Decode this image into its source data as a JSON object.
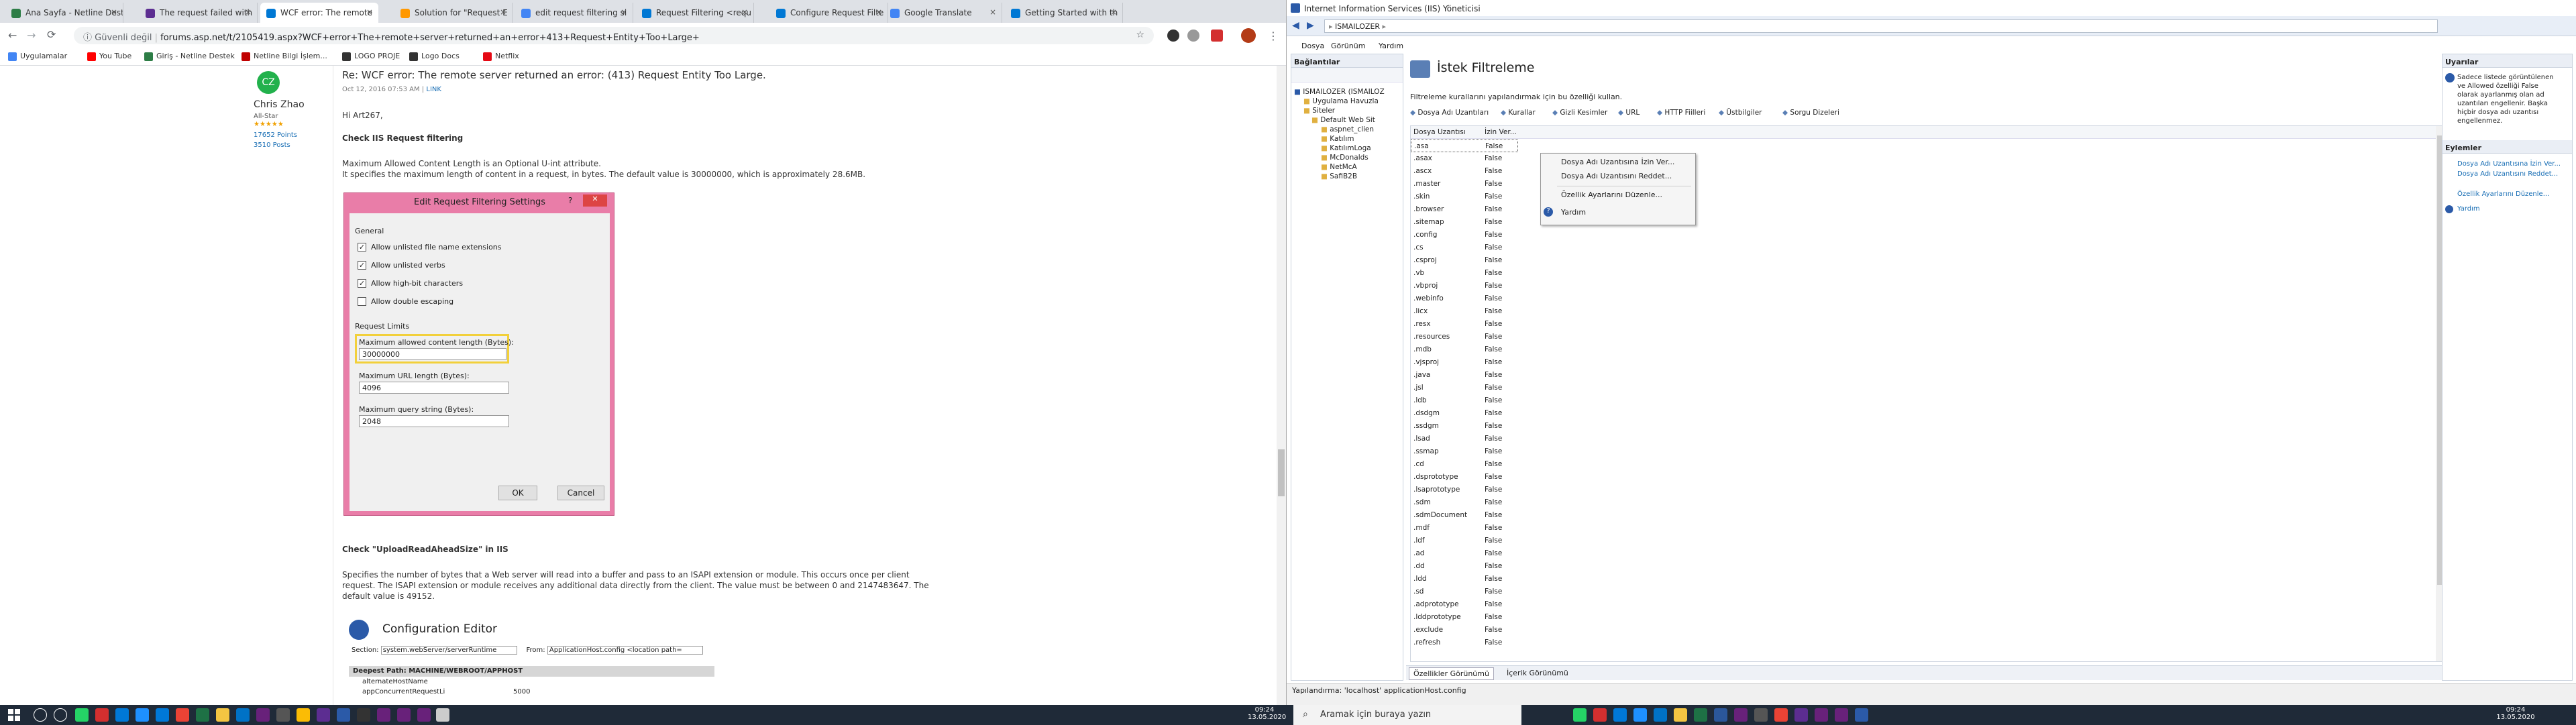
{
  "browser": {
    "tabs": [
      {
        "title": "Ana Sayfa - Netline Dest",
        "color": "#2d7d46"
      },
      {
        "title": "The request failed with",
        "color": "#5c2d91"
      },
      {
        "title": "WCF error: The remote",
        "color": "#0078d4"
      },
      {
        "title": "Solution for \"Request E",
        "color": "#ff9800"
      },
      {
        "title": "edit request filtering si",
        "color": "#4285f4"
      },
      {
        "title": "Request Filtering <requ",
        "color": "#0078d4"
      },
      {
        "title": "Configure Request Filte",
        "color": "#0078d4"
      },
      {
        "title": "Google Translate",
        "color": "#4285f4"
      },
      {
        "title": "Getting Started with th",
        "color": "#0078d4"
      }
    ],
    "security_label": "Güvenli değil",
    "url": "forums.asp.net/t/2105419.aspx?WCF+error+The+remote+server+returned+an+error+413+Request+Entity+Too+Large+",
    "bookmarks": [
      {
        "label": "Uygulamalar",
        "color": "#4285f4"
      },
      {
        "label": "You Tube",
        "color": "#ff0000"
      },
      {
        "label": "Giriş - Netline Destek",
        "color": "#2d7d46"
      },
      {
        "label": "Netline Bilgi İşlem...",
        "color": "#c00000"
      },
      {
        "label": "LOGO PROJE",
        "color": "#333333"
      },
      {
        "label": "Logo Docs",
        "color": "#333333"
      },
      {
        "label": "Netflix",
        "color": "#e50914"
      }
    ]
  },
  "post": {
    "title": "Re: WCF error: The remote server returned an error: (413) Request Entity Too Large.",
    "date": "Oct 12, 2016 07:53 AM",
    "link": "LINK",
    "author_initials": "CZ",
    "author_name": "Chris Zhao",
    "author_rank": "All-Star",
    "author_stars": "★★★★★",
    "points": "17652 Points",
    "posts": "3510 Posts",
    "greeting": "Hi Art267,",
    "heading1": "Check IIS Request filtering",
    "para1_line1": "Maximum Allowed Content Length is an Optional U-int attribute.",
    "para1_line2": "It specifies the maximum length of content in a request, in bytes. The default value is 30000000, which is approximately 28.6MB.",
    "heading2": "Check \"UploadReadAheadSize\" in IIS",
    "para2_line1": "Specifies the number of bytes that a Web server will read into a buffer and pass to an ISAPI extension or module. This occurs once per client",
    "para2_line2": "request. The ISAPI extension or module receives any additional data directly from the client. The value must be between 0 and 2147483647. The",
    "para2_line3": "default value is 49152.",
    "config_title": "Configuration Editor",
    "config_section_label": "Section:",
    "config_section_value": "system.webServer/serverRuntime",
    "config_from_label": "From:",
    "config_from_value": "ApplicationHost.config <location path=",
    "config_deepest": "Deepest Path: MACHINE/WEBROOT/APPHOST",
    "config_row1": "alternateHostName",
    "config_row2": "appConcurrentRequestLi",
    "config_row2_val": "5000"
  },
  "dialog": {
    "title": "Edit Request Filtering Settings",
    "help": "?",
    "close": "✕",
    "general_label": "General",
    "opt1": "Allow unlisted file name extensions",
    "opt2": "Allow unlisted verbs",
    "opt3": "Allow high-bit characters",
    "opt4": "Allow double escaping",
    "opt1_checked": "✓",
    "opt2_checked": "✓",
    "opt3_checked": "✓",
    "limits_label": "Request Limits",
    "max_content_label": "Maximum allowed content length (Bytes):",
    "max_content_value": "30000000",
    "max_url_label": "Maximum URL length (Bytes):",
    "max_url_value": "4096",
    "max_query_label": "Maximum query string (Bytes):",
    "max_query_value": "2048",
    "ok": "OK",
    "cancel": "Cancel"
  },
  "iis": {
    "window_title": "Internet Information Services (IIS) Yöneticisi",
    "address": "ISMAILOZER",
    "menu": [
      "Dosya",
      "Görünüm",
      "Yardım"
    ],
    "connections_title": "Bağlantılar",
    "tree": [
      "ISMAILOZER (ISMAILOZ",
      "Uygulama Havuzla",
      "Siteler",
      "Default Web Sit",
      "aspnet_clien",
      "Katılım",
      "KatılımLoga",
      "McDonalds",
      "NetMcA",
      "SafiB2B"
    ],
    "feature_title": "İstek Filtreleme",
    "feature_desc": "Filtreleme kurallarını yapılandırmak için bu özelliği kullan.",
    "subtabs": [
      "Dosya Adı Uzantıları",
      "Kurallar",
      "Gizli Kesimler",
      "URL",
      "HTTP Fiilleri",
      "Üstbilgiler",
      "Sorgu Dizeleri"
    ],
    "col_ext": "Dosya Uzantısı",
    "col_allowed": "İzin Ver...",
    "extensions": [
      ".asa",
      ".asax",
      ".ascx",
      ".master",
      ".skin",
      ".browser",
      ".sitemap",
      ".config",
      ".cs",
      ".csproj",
      ".vb",
      ".vbproj",
      ".webinfo",
      ".licx",
      ".resx",
      ".resources",
      ".mdb",
      ".vjsproj",
      ".java",
      ".jsl",
      ".ldb",
      ".dsdgm",
      ".ssdgm",
      ".lsad",
      ".ssmap",
      ".cd",
      ".dsprototype",
      ".lsaprototype",
      ".sdm",
      ".sdmDocument",
      ".mdf",
      ".ldf",
      ".ad",
      ".dd",
      ".ldd",
      ".sd",
      ".adprototype",
      ".lddprototype",
      ".exclude",
      ".refresh"
    ],
    "allowed_value": "False",
    "context_menu": [
      "Dosya Adı Uzantısına İzin Ver...",
      "Dosya Adı Uzantısını Reddet...",
      "Özellik Ayarlarını Düzenle...",
      "Yardım"
    ],
    "bottom_tabs": [
      "Özellikler Görünümü",
      "İçerik Görünümü"
    ],
    "status": "Yapılandırma: 'localhost' applicationHost.config",
    "alerts_title": "Uyarılar",
    "alert_text_1": "Sadece listede görüntülenen",
    "alert_text_2": "ve Allowed özelliği False",
    "alert_text_3": "olarak ayarlanmış olan ad",
    "alert_text_4": "uzantıları engellenir. Başka",
    "alert_text_5": "hiçbir dosya adı uzantısı",
    "alert_text_6": "engellenmez.",
    "actions_title": "Eylemler",
    "actions": [
      "Dosya Adı Uzantısına İzin Ver...",
      "Dosya Adı Uzantısını Reddet...",
      "Özellik Ayarlarını Düzenle...",
      "Yardım"
    ]
  },
  "taskbar": {
    "time_left": "09:24",
    "date_left": "13.05.2020",
    "search_placeholder": "Aramak için buraya yazın",
    "time_right": "09:24",
    "date_right": "13.05.2020"
  }
}
